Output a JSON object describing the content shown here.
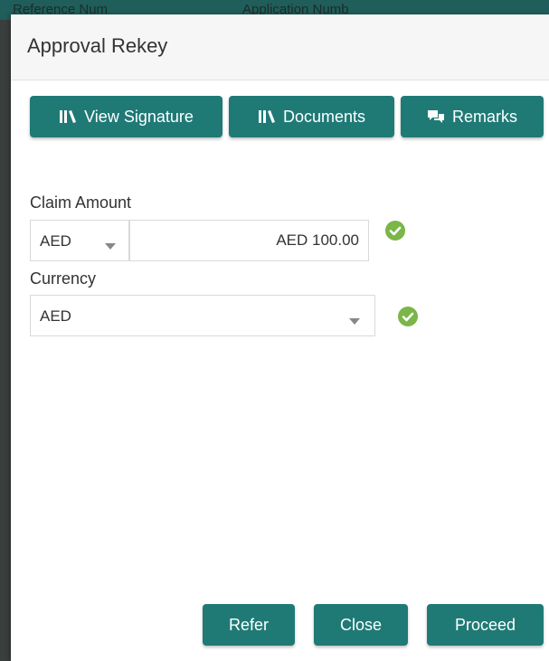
{
  "background": {
    "column_1": "Reference Num",
    "column_2": "Application Numb"
  },
  "modal": {
    "title": "Approval Rekey"
  },
  "toolbar": {
    "view_signature_label": "View Signature",
    "documents_label": "Documents",
    "remarks_label": "Remarks"
  },
  "form": {
    "claim_amount": {
      "label": "Claim Amount",
      "currency_value": "AED",
      "amount_value": "AED 100.00",
      "validated": true
    },
    "currency": {
      "label": "Currency",
      "value": "AED",
      "validated": true
    }
  },
  "footer": {
    "refer_label": "Refer",
    "close_label": "Close",
    "proceed_label": "Proceed"
  },
  "colors": {
    "primary_button": "#1f7a76",
    "valid_check": "#7ab648"
  },
  "icons": {
    "library": "library-icon",
    "remarks": "chat-bubbles-icon",
    "valid": "check-circle-icon",
    "dropdown": "caret-down-icon"
  }
}
